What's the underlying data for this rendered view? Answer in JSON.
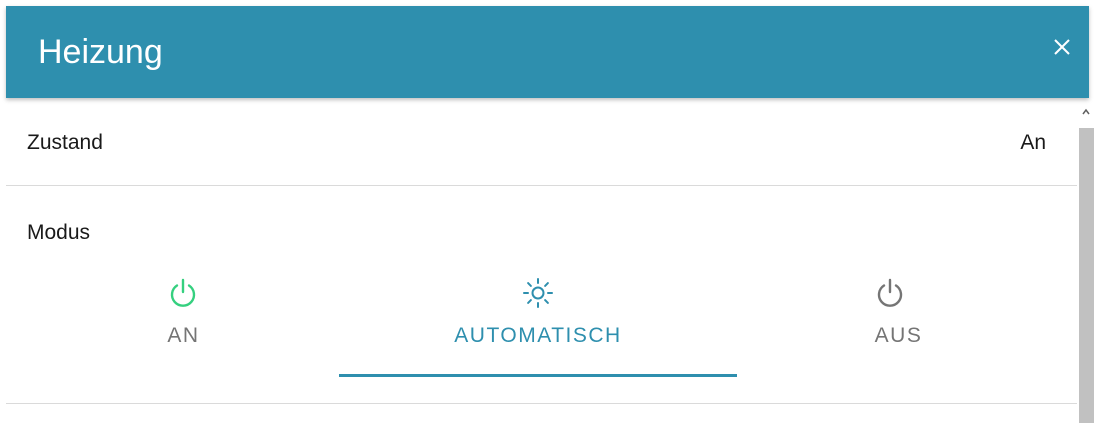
{
  "dialog": {
    "title": "Heizung",
    "close_icon": "close-icon"
  },
  "state": {
    "label": "Zustand",
    "value": "An"
  },
  "mode": {
    "label": "Modus",
    "selected": "AUTOMATISCH",
    "tabs": [
      {
        "label": "AN",
        "icon": "power-icon",
        "color": "#35d07f"
      },
      {
        "label": "AUTOMATISCH",
        "icon": "sun-icon",
        "color": "#2e8fae"
      },
      {
        "label": "AUS",
        "icon": "power-icon",
        "color": "#757575"
      }
    ]
  },
  "colors": {
    "accent": "#2e8fae",
    "on": "#35d07f",
    "off": "#757575"
  }
}
